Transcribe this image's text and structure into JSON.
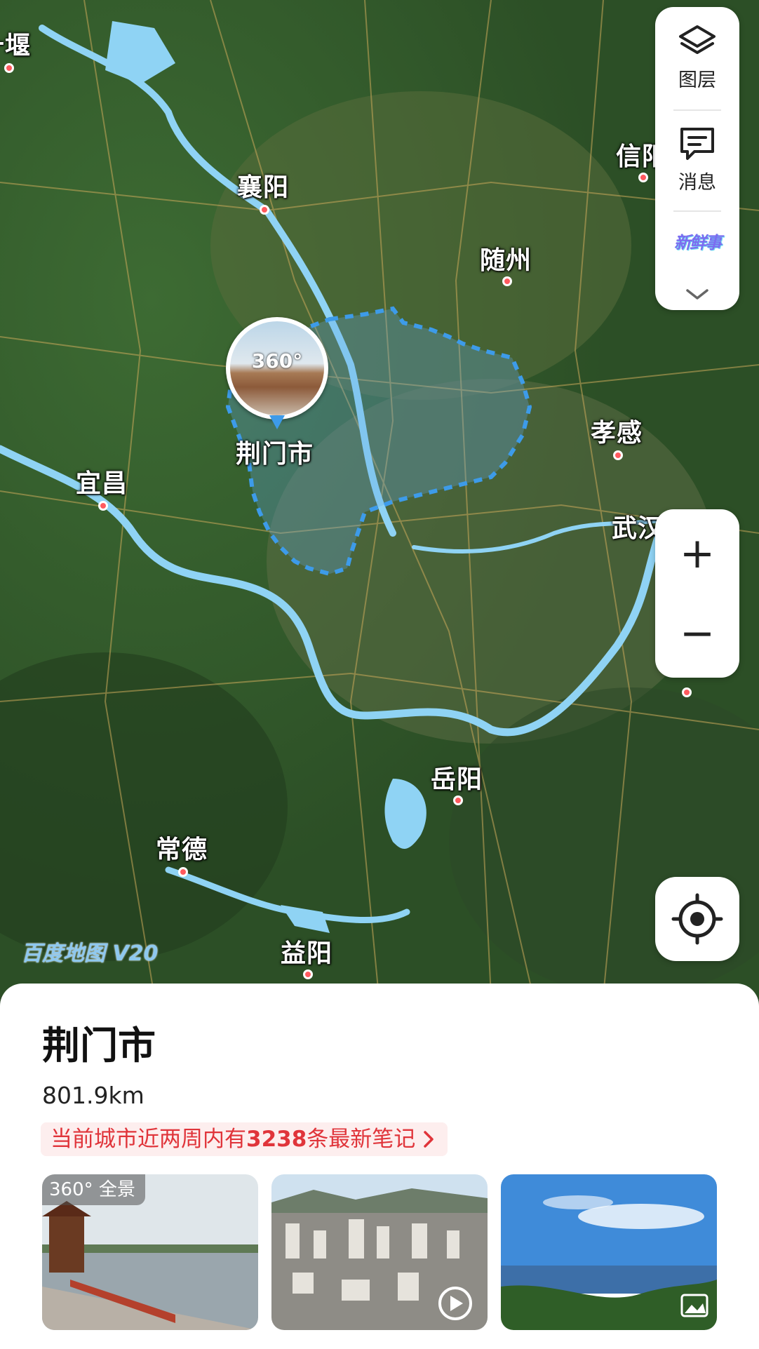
{
  "map": {
    "cities": [
      {
        "name": "十堰"
      },
      {
        "name": "襄阳"
      },
      {
        "name": "信阳"
      },
      {
        "name": "随州"
      },
      {
        "name": "孝感"
      },
      {
        "name": "宜昌"
      },
      {
        "name": "武汉"
      },
      {
        "name": "岳阳"
      },
      {
        "name": "常德"
      },
      {
        "name": "益阳"
      }
    ],
    "highlight_label": "荆门市",
    "panorama_badge": "360°",
    "watermark": "百度地图 V20",
    "river_color": "#8fd3f4",
    "boundary_color": "#3d9be9"
  },
  "toolbar": {
    "layers_label": "图层",
    "messages_label": "消息",
    "news_label": "新鲜事"
  },
  "zoom": {
    "in_label": "+",
    "out_label": "−"
  },
  "sheet": {
    "title": "荆门市",
    "distance": "801.9km",
    "notes_prefix": "当前城市近两周内有",
    "notes_count": "3238",
    "notes_suffix": "条最新笔记",
    "pano_badge": "360° 全景"
  },
  "colors": {
    "accent_red": "#e0343a",
    "notes_bg": "#fdeeee"
  }
}
